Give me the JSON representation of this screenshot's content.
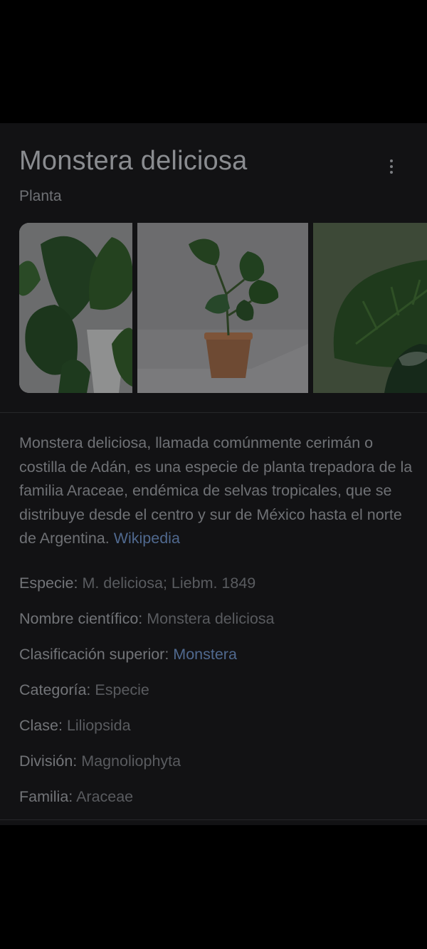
{
  "panel": {
    "title": "Monstera deliciosa",
    "subtitle": "Planta",
    "description": "Monstera deliciosa, llamada comúnmente cerimán o costilla de Adán, es una especie de planta trepadora de la familia Araceae, endémica de selvas tropicales, que se distribuye desde el centro y sur de México hasta el norte de Argentina.",
    "source_link": "Wikipedia"
  },
  "images": [
    {
      "icon": "monstera-plant-photo"
    },
    {
      "icon": "potted-monstera-photo"
    },
    {
      "icon": "monstera-leaf-closeup-photo"
    }
  ],
  "facts": [
    {
      "label": "Especie:",
      "value": "M. deliciosa; Liebm. 1849"
    },
    {
      "label": "Nombre científico:",
      "value": "Monstera deliciosa"
    },
    {
      "label": "Clasificación superior:",
      "value": "Monstera"
    },
    {
      "label": "Categoría:",
      "value": "Especie"
    },
    {
      "label": "Clase:",
      "value": "Liliopsida"
    },
    {
      "label": "División:",
      "value": "Magnoliophyta"
    },
    {
      "label": "Familia:",
      "value": "Araceae"
    }
  ],
  "colors": {
    "background": "#000000",
    "card": "#121214",
    "link": "#50698f"
  }
}
